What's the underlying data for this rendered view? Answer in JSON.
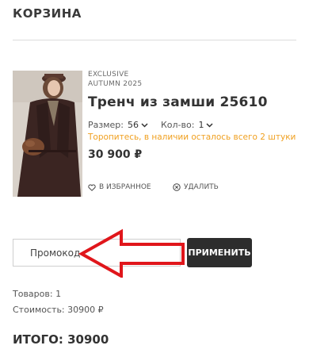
{
  "page": {
    "title": "КОРЗИНА"
  },
  "cart_item": {
    "label": "EXCLUSIVE",
    "collection": "AUTUMN 2025",
    "name": "Тренч из замши 25610",
    "size_label": "Размер:",
    "size_value": "56",
    "qty_label": "Кол-во:",
    "qty_value": "1",
    "stock_warning": "Торопитесь, в наличии осталось всего 2 штуки",
    "price": "30 900 ₽",
    "favorite_label": "В ИЗБРАННОЕ",
    "remove_label": "УДАЛИТЬ"
  },
  "promo": {
    "placeholder": "Промокод",
    "apply_label": "ПРИМЕНИТЬ"
  },
  "summary": {
    "items_text": "Товаров: 1",
    "cost_text": "Стоимость: 30900 ₽",
    "total_text": "ИТОГО: 30900"
  },
  "colors": {
    "warning": "#f0a020",
    "button": "#2d2d2d",
    "annotation_arrow": "#e0161b"
  },
  "icons": [
    "chevron-down-icon",
    "heart-icon",
    "remove-circle-icon",
    "red-pointer-arrow"
  ]
}
